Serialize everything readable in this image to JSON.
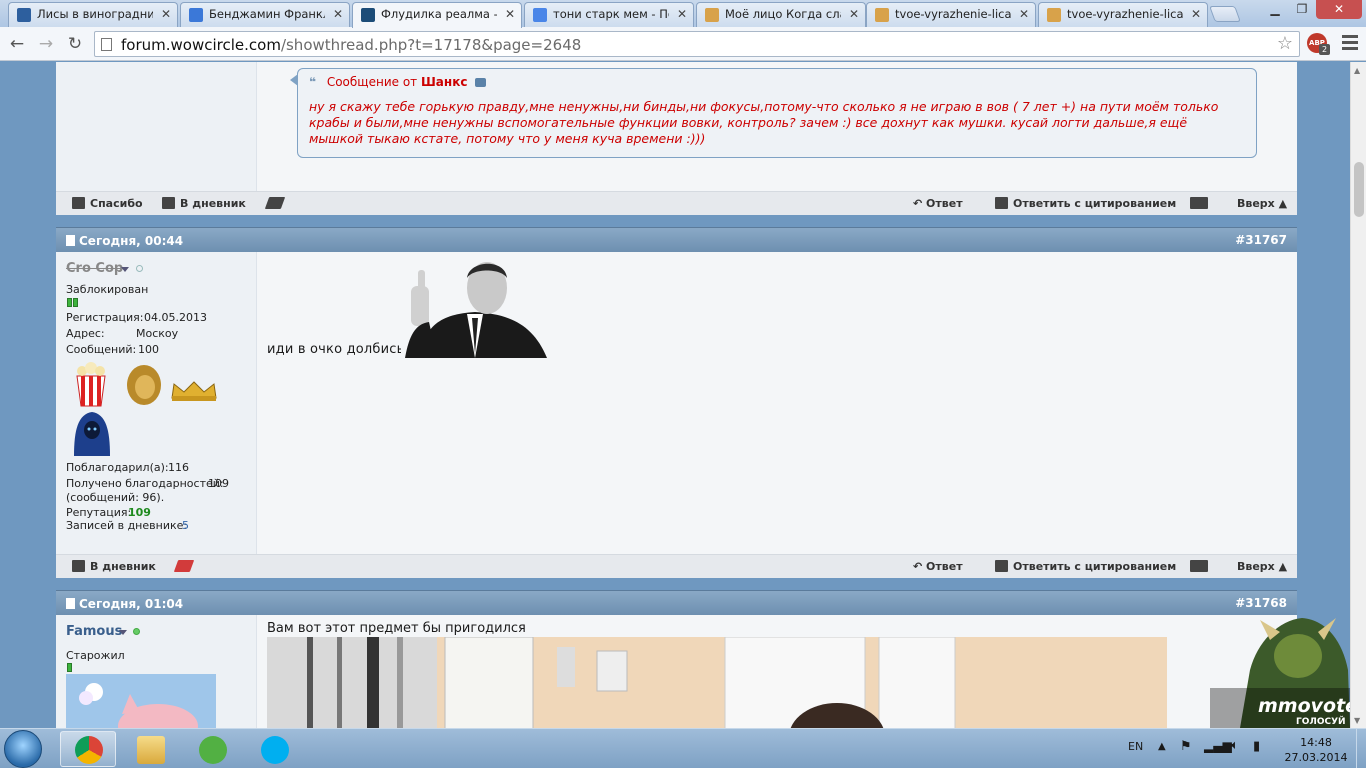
{
  "browser": {
    "tabs": [
      {
        "title": "Лисы в виноградниках",
        "active": false,
        "icon": "document-icon"
      },
      {
        "title": "Бенджамин Франклин",
        "active": false,
        "icon": "docs-icon"
      },
      {
        "title": "Флудилка реалма - C",
        "active": true,
        "icon": "forum-icon"
      },
      {
        "title": "тони старк мем - Пои",
        "active": false,
        "icon": "google-icon"
      },
      {
        "title": "Моё лицо Когда слаб",
        "active": false,
        "icon": "image-icon"
      },
      {
        "title": "tvoe-vyrazhenie-lica_4",
        "active": false,
        "icon": "image-icon"
      },
      {
        "title": "tvoe-vyrazhenie-lica_4",
        "active": false,
        "icon": "image-icon"
      }
    ],
    "url_host": "forum.wowcircle.com",
    "url_path": "/showthread.php?t=17178&page=2648",
    "abp_label": "ABP",
    "abp_count": "2"
  },
  "colors": {
    "quote_text": "#cc0000",
    "reputation": "#1e8a1e",
    "post_header": "#7496b8",
    "online": "#3db43d"
  },
  "quote": {
    "prefix": "Сообщение от",
    "author": "Шанкс",
    "text": "ну я скажу тебе горькую правду,мне ненужны,ни бинды,ни фокусы,потому-что сколько я не играю в вов ( 7 лет +) на пути моём только крабы и были,мне ненужны вспомогательные функции вовки, контроль? зачем :) все дохнут как мушки. кусай логти дальше,я ещё мышкой тыкаю кстате, потому что у меня куча времени :)))"
  },
  "actions1": {
    "thanks": "Спасибо",
    "diary": "В дневник",
    "reply": "Ответ",
    "quote_reply": "Ответить с цитированием",
    "top": "Вверх ▲"
  },
  "post1": {
    "date": "Сегодня, 00:44",
    "number": "#31767",
    "username": "Cro Cop",
    "status": "Заблокирован",
    "reg_label": "Регистрация:",
    "reg_value": "04.05.2013",
    "addr_label": "Адрес:",
    "addr_value": "Москоу",
    "msgs_label": "Сообщений:",
    "msgs_value": "100",
    "thanked_label": "Поблагодарил(а):",
    "thanked_value": "116",
    "received_label": "Получено благодарностей:",
    "received_value": "109",
    "received_note": "(сообщений: 96).",
    "rep_label": "Репутация:",
    "rep_value": "109",
    "diary_label": "Записей в дневнике:",
    "diary_value": "5",
    "message": "иди в очко долбись"
  },
  "actions2": {
    "diary": "В дневник",
    "reply": "Ответ",
    "quote_reply": "Ответить с цитированием",
    "top": "Вверх ▲"
  },
  "post2": {
    "date": "Сегодня, 01:04",
    "number": "#31768",
    "username": "Famous",
    "status": "Старожил",
    "message": "Вам вот этот предмет бы пригодился"
  },
  "overlay": {
    "brand": "mmovote",
    "caption": "ГОЛОСУЙ"
  },
  "taskbar": {
    "lang": "EN",
    "time": "14:48",
    "date": "27.03.2014",
    "apps": [
      "chrome-icon",
      "explorer-icon",
      "utorrent-icon",
      "skype-icon"
    ]
  }
}
